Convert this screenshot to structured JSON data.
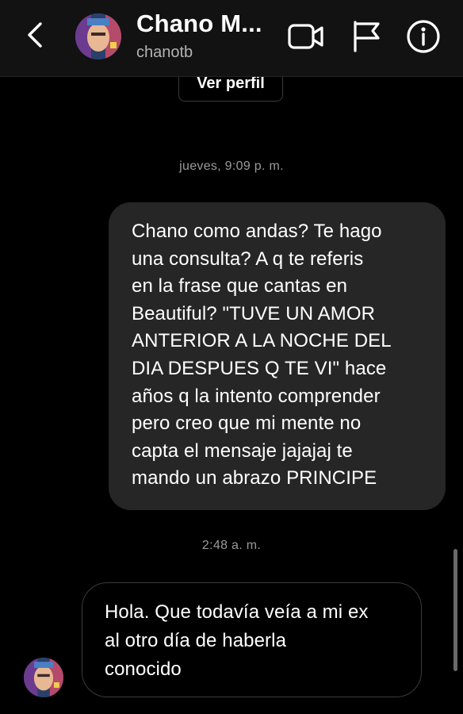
{
  "header": {
    "contact_name": "Chano M...",
    "username": "chanotb",
    "back_icon": "chevron-left-icon",
    "video_icon": "video-call-icon",
    "flag_icon": "flag-icon",
    "info_icon": "info-icon"
  },
  "thread": {
    "profile_button_label": "Ver perfil",
    "messages": [
      {
        "timestamp": "jueves, 9:09 p. m.",
        "direction": "outgoing",
        "text": "Chano como andas? Te hago\nuna consulta? A q te referis\nen la frase que cantas en\nBeautiful? \"TUVE UN AMOR\nANTERIOR A LA NOCHE DEL\nDIA DESPUES Q TE VI\" hace\naños q la intento comprender\npero creo que mi mente no\ncapta el mensaje jajajaj te\nmando un abrazo PRINCIPE"
      },
      {
        "timestamp": "2:48 a. m.",
        "direction": "incoming",
        "text": "Hola. Que todavía veía a mi ex\nal otro día de haberla\nconocido"
      }
    ]
  },
  "colors": {
    "background": "#000000",
    "header_bg": "#121212",
    "outgoing_bubble": "#262626",
    "incoming_border": "#3b3b3b",
    "timestamp_text": "#9a9a9a",
    "username_text": "#b3b3b3"
  }
}
